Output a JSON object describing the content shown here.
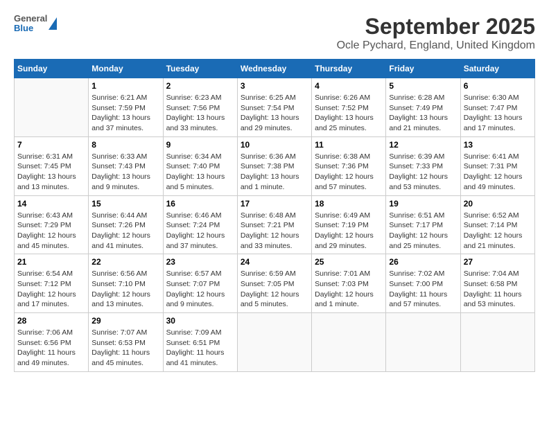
{
  "header": {
    "logo_line1": "General",
    "logo_line2": "Blue",
    "title": "September 2025",
    "subtitle": "Ocle Pychard, England, United Kingdom"
  },
  "days_of_week": [
    "Sunday",
    "Monday",
    "Tuesday",
    "Wednesday",
    "Thursday",
    "Friday",
    "Saturday"
  ],
  "weeks": [
    [
      {
        "num": "",
        "info": ""
      },
      {
        "num": "1",
        "info": "Sunrise: 6:21 AM\nSunset: 7:59 PM\nDaylight: 13 hours\nand 37 minutes."
      },
      {
        "num": "2",
        "info": "Sunrise: 6:23 AM\nSunset: 7:56 PM\nDaylight: 13 hours\nand 33 minutes."
      },
      {
        "num": "3",
        "info": "Sunrise: 6:25 AM\nSunset: 7:54 PM\nDaylight: 13 hours\nand 29 minutes."
      },
      {
        "num": "4",
        "info": "Sunrise: 6:26 AM\nSunset: 7:52 PM\nDaylight: 13 hours\nand 25 minutes."
      },
      {
        "num": "5",
        "info": "Sunrise: 6:28 AM\nSunset: 7:49 PM\nDaylight: 13 hours\nand 21 minutes."
      },
      {
        "num": "6",
        "info": "Sunrise: 6:30 AM\nSunset: 7:47 PM\nDaylight: 13 hours\nand 17 minutes."
      }
    ],
    [
      {
        "num": "7",
        "info": "Sunrise: 6:31 AM\nSunset: 7:45 PM\nDaylight: 13 hours\nand 13 minutes."
      },
      {
        "num": "8",
        "info": "Sunrise: 6:33 AM\nSunset: 7:43 PM\nDaylight: 13 hours\nand 9 minutes."
      },
      {
        "num": "9",
        "info": "Sunrise: 6:34 AM\nSunset: 7:40 PM\nDaylight: 13 hours\nand 5 minutes."
      },
      {
        "num": "10",
        "info": "Sunrise: 6:36 AM\nSunset: 7:38 PM\nDaylight: 13 hours\nand 1 minute."
      },
      {
        "num": "11",
        "info": "Sunrise: 6:38 AM\nSunset: 7:36 PM\nDaylight: 12 hours\nand 57 minutes."
      },
      {
        "num": "12",
        "info": "Sunrise: 6:39 AM\nSunset: 7:33 PM\nDaylight: 12 hours\nand 53 minutes."
      },
      {
        "num": "13",
        "info": "Sunrise: 6:41 AM\nSunset: 7:31 PM\nDaylight: 12 hours\nand 49 minutes."
      }
    ],
    [
      {
        "num": "14",
        "info": "Sunrise: 6:43 AM\nSunset: 7:29 PM\nDaylight: 12 hours\nand 45 minutes."
      },
      {
        "num": "15",
        "info": "Sunrise: 6:44 AM\nSunset: 7:26 PM\nDaylight: 12 hours\nand 41 minutes."
      },
      {
        "num": "16",
        "info": "Sunrise: 6:46 AM\nSunset: 7:24 PM\nDaylight: 12 hours\nand 37 minutes."
      },
      {
        "num": "17",
        "info": "Sunrise: 6:48 AM\nSunset: 7:21 PM\nDaylight: 12 hours\nand 33 minutes."
      },
      {
        "num": "18",
        "info": "Sunrise: 6:49 AM\nSunset: 7:19 PM\nDaylight: 12 hours\nand 29 minutes."
      },
      {
        "num": "19",
        "info": "Sunrise: 6:51 AM\nSunset: 7:17 PM\nDaylight: 12 hours\nand 25 minutes."
      },
      {
        "num": "20",
        "info": "Sunrise: 6:52 AM\nSunset: 7:14 PM\nDaylight: 12 hours\nand 21 minutes."
      }
    ],
    [
      {
        "num": "21",
        "info": "Sunrise: 6:54 AM\nSunset: 7:12 PM\nDaylight: 12 hours\nand 17 minutes."
      },
      {
        "num": "22",
        "info": "Sunrise: 6:56 AM\nSunset: 7:10 PM\nDaylight: 12 hours\nand 13 minutes."
      },
      {
        "num": "23",
        "info": "Sunrise: 6:57 AM\nSunset: 7:07 PM\nDaylight: 12 hours\nand 9 minutes."
      },
      {
        "num": "24",
        "info": "Sunrise: 6:59 AM\nSunset: 7:05 PM\nDaylight: 12 hours\nand 5 minutes."
      },
      {
        "num": "25",
        "info": "Sunrise: 7:01 AM\nSunset: 7:03 PM\nDaylight: 12 hours\nand 1 minute."
      },
      {
        "num": "26",
        "info": "Sunrise: 7:02 AM\nSunset: 7:00 PM\nDaylight: 11 hours\nand 57 minutes."
      },
      {
        "num": "27",
        "info": "Sunrise: 7:04 AM\nSunset: 6:58 PM\nDaylight: 11 hours\nand 53 minutes."
      }
    ],
    [
      {
        "num": "28",
        "info": "Sunrise: 7:06 AM\nSunset: 6:56 PM\nDaylight: 11 hours\nand 49 minutes."
      },
      {
        "num": "29",
        "info": "Sunrise: 7:07 AM\nSunset: 6:53 PM\nDaylight: 11 hours\nand 45 minutes."
      },
      {
        "num": "30",
        "info": "Sunrise: 7:09 AM\nSunset: 6:51 PM\nDaylight: 11 hours\nand 41 minutes."
      },
      {
        "num": "",
        "info": ""
      },
      {
        "num": "",
        "info": ""
      },
      {
        "num": "",
        "info": ""
      },
      {
        "num": "",
        "info": ""
      }
    ]
  ]
}
